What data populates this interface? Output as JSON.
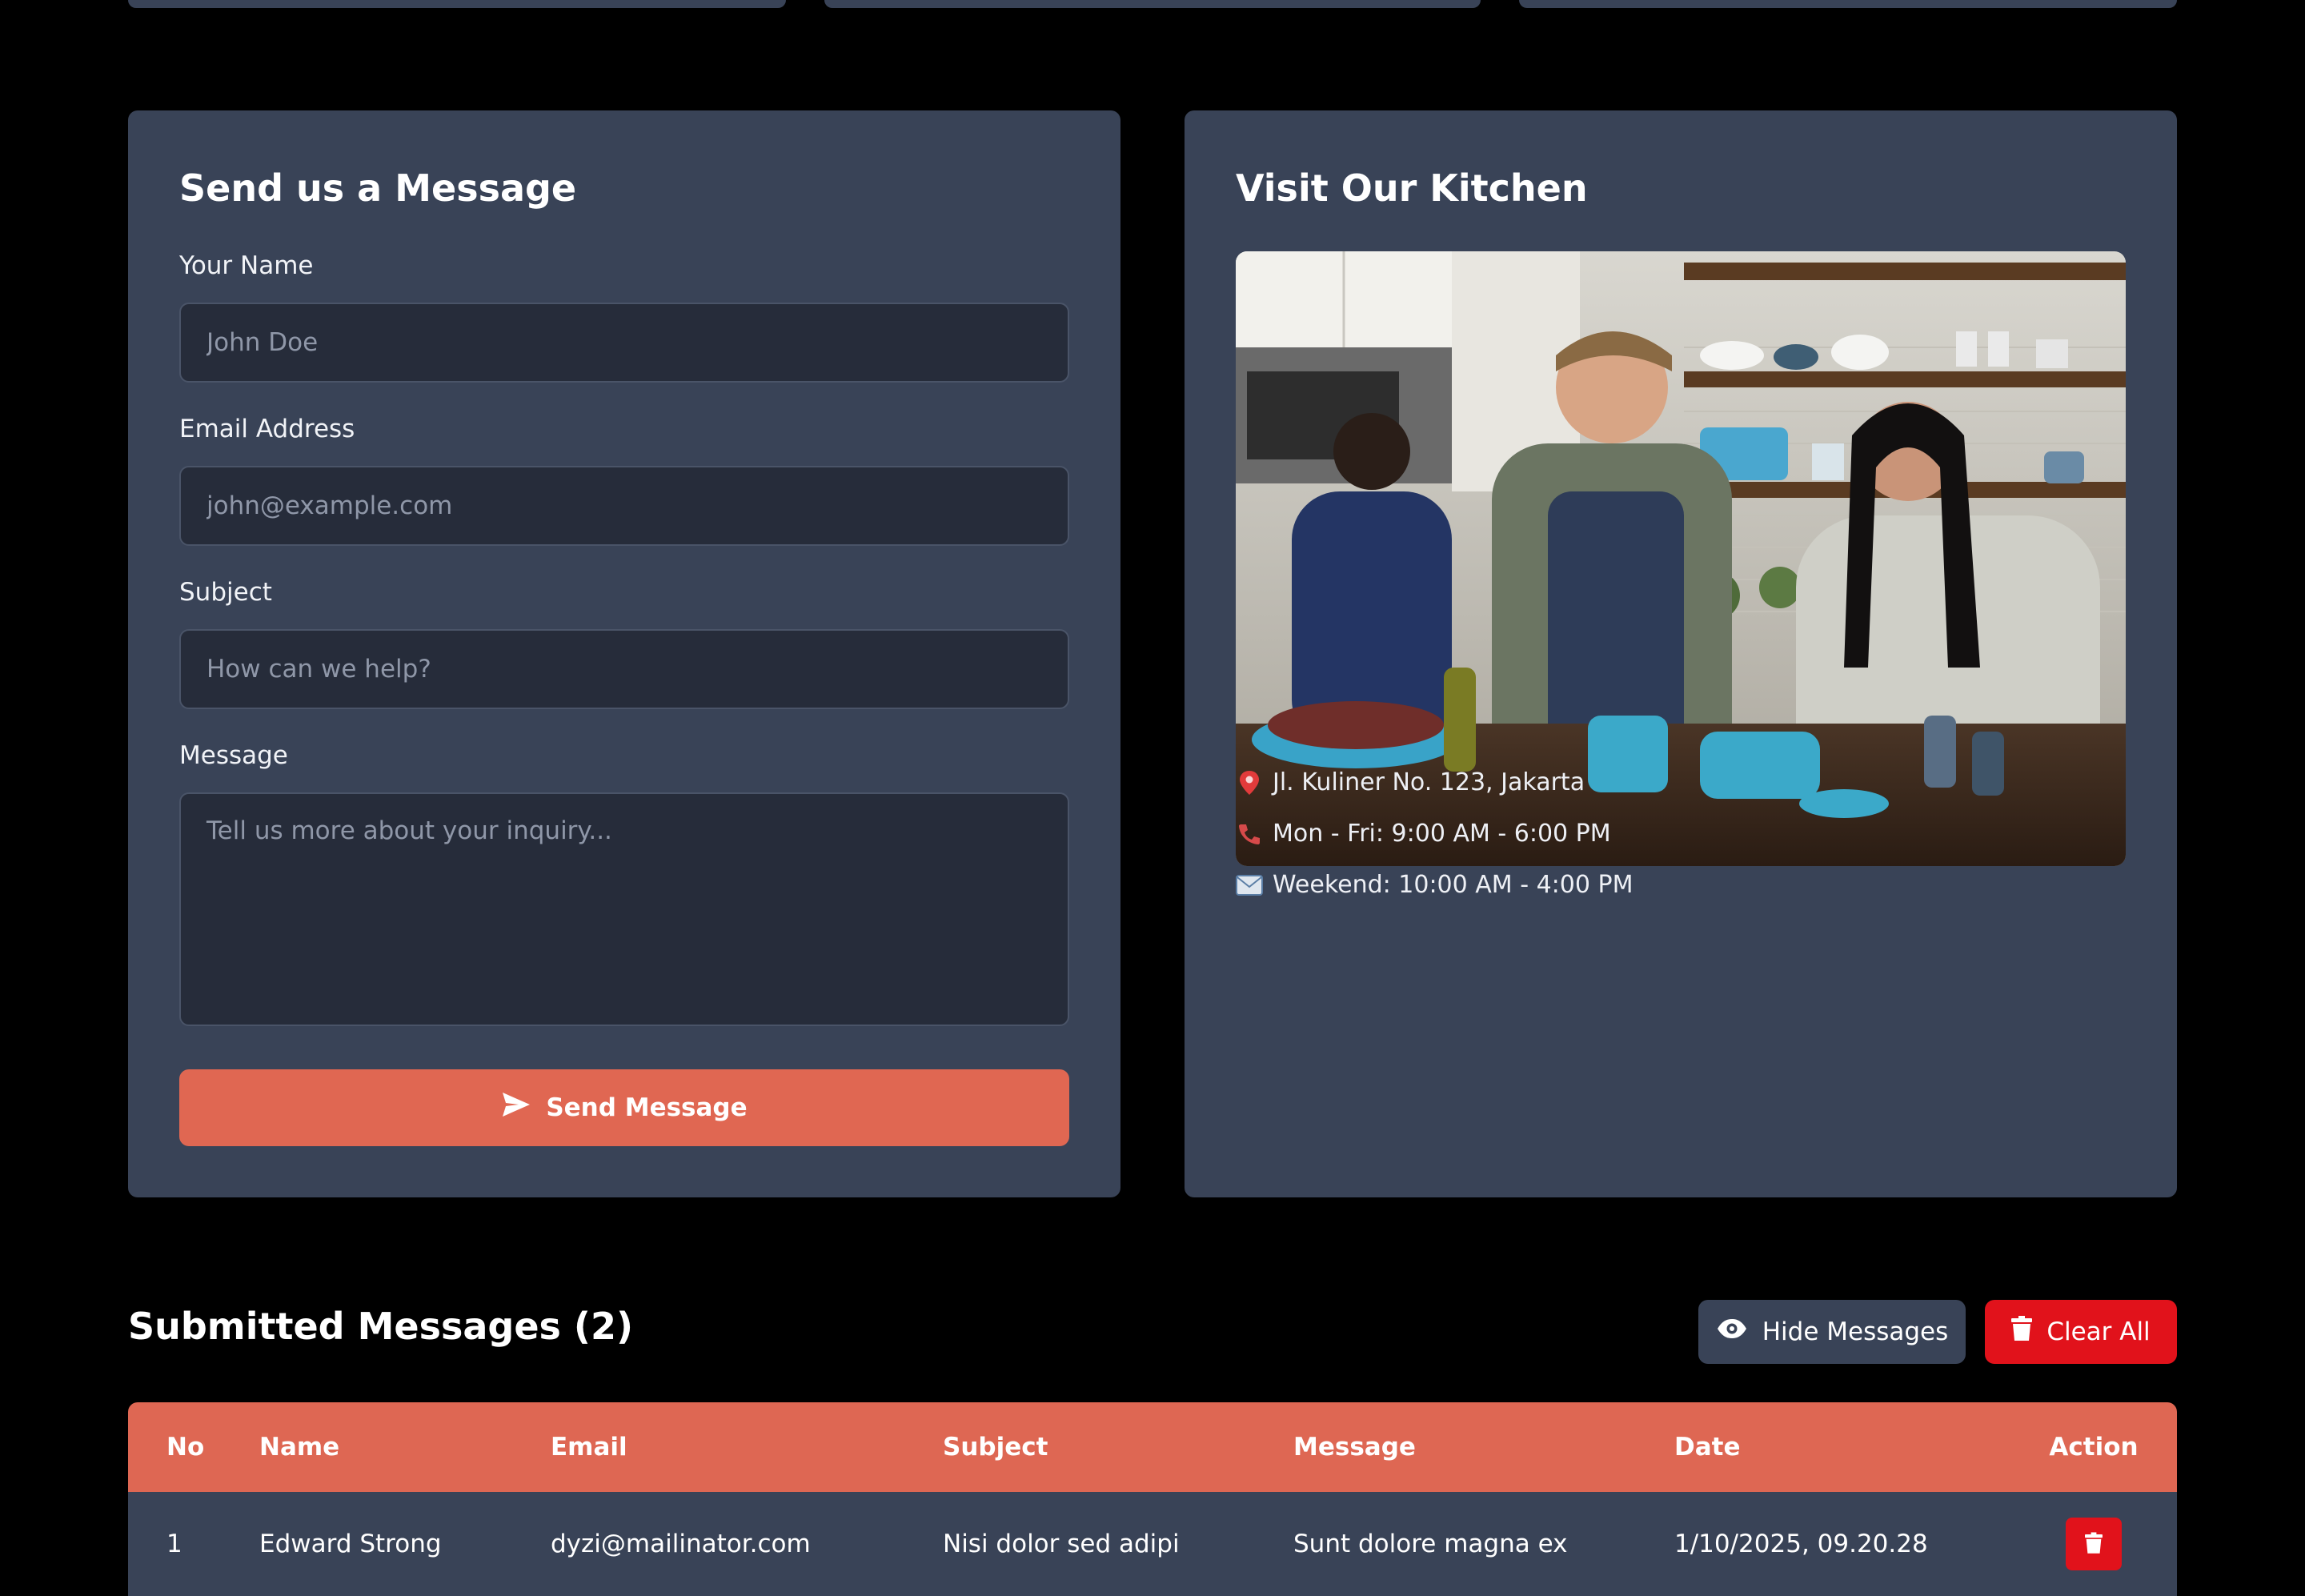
{
  "contact_form": {
    "title": "Send us a Message",
    "name_label": "Your Name",
    "name_placeholder": "John Doe",
    "email_label": "Email Address",
    "email_placeholder": "john@example.com",
    "subject_label": "Subject",
    "subject_placeholder": "How can we help?",
    "message_label": "Message",
    "message_placeholder": "Tell us more about your inquiry...",
    "submit_label": "Send Message"
  },
  "kitchen": {
    "title": "Visit Our Kitchen",
    "photo_description": "",
    "info": [
      {
        "icon": "pin-icon",
        "text": "Jl. Kuliner No. 123, Jakarta"
      },
      {
        "icon": "phone-icon",
        "text": "Mon - Fri: 9:00 AM - 6:00 PM"
      },
      {
        "icon": "email-icon",
        "text": "Weekend: 10:00 AM - 4:00 PM"
      }
    ]
  },
  "messages": {
    "title": "Submitted Messages (2)",
    "hide_label": "Hide Messages",
    "clear_label": "Clear All",
    "columns": [
      "No",
      "Name",
      "Email",
      "Subject",
      "Message",
      "Date",
      "Action"
    ],
    "rows": [
      {
        "no": "1",
        "name": "Edward Strong",
        "email": "dyzi@mailinator.com",
        "subject": "Nisi dolor sed adipi",
        "message": "Sunt dolore magna ex",
        "date": "1/10/2025, 09.20.28"
      }
    ]
  },
  "colors": {
    "background": "#000000",
    "panel": "#394357",
    "input": "#262c3a",
    "accent": "#e06752",
    "danger": "#e1121b"
  }
}
